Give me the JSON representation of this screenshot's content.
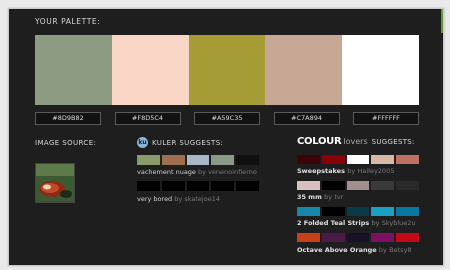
{
  "header": {
    "title": "YOUR PALETTE:"
  },
  "palette": [
    {
      "color": "#8D9B82",
      "label": "#8D9B82"
    },
    {
      "color": "#F8D5C4",
      "label": "#F8D5C4"
    },
    {
      "color": "#A59C35",
      "label": "#A59C35"
    },
    {
      "color": "#C7A894",
      "label": "#C7A894"
    },
    {
      "color": "#FFFFFF",
      "label": "#FFFFFF"
    }
  ],
  "image_source": {
    "label": "IMAGE SOURCE:"
  },
  "kuler": {
    "logo": "ku",
    "label": "KULER SUGGESTS:",
    "items": [
      {
        "name": "vachement nuage",
        "by": "by",
        "author": "venenoinfierno",
        "colors": [
          "#8a9a6a",
          "#9e7050",
          "#a8b8c8",
          "#8a9a86",
          "#101010"
        ]
      },
      {
        "name": "very bored",
        "by": "by",
        "author": "skatejoe14",
        "colors": [
          "#000000",
          "#000000",
          "#000000",
          "#000000",
          "#000000"
        ]
      }
    ]
  },
  "colourlovers": {
    "colour": "COLOUR",
    "lovers": "lovers",
    "suggests": "SUGGESTS:",
    "items": [
      {
        "name": "Sweepstakes",
        "by": "by",
        "author": "Hailey2005",
        "colors": [
          "#3a0408",
          "#8a0008",
          "#ffffff",
          "#d8b8a8",
          "#c07060"
        ]
      },
      {
        "name": "35 mm",
        "by": "by",
        "author": "tvr",
        "colors": [
          "#d8c0c0",
          "#000000",
          "#a09090",
          "#3a3a3a",
          "#2a2a2a"
        ]
      },
      {
        "name": "2 Folded Teal Strips",
        "by": "by",
        "author": "Skyblue2u",
        "colors": [
          "#1888a8",
          "#000000",
          "#0a3a48",
          "#1aa0c0",
          "#0878a0"
        ]
      },
      {
        "name": "Octave Above Orange",
        "by": "by",
        "author": "Betsy8",
        "colors": [
          "#c84018",
          "#4a1a48",
          "#181028",
          "#7a1060",
          "#c80818"
        ]
      }
    ]
  }
}
